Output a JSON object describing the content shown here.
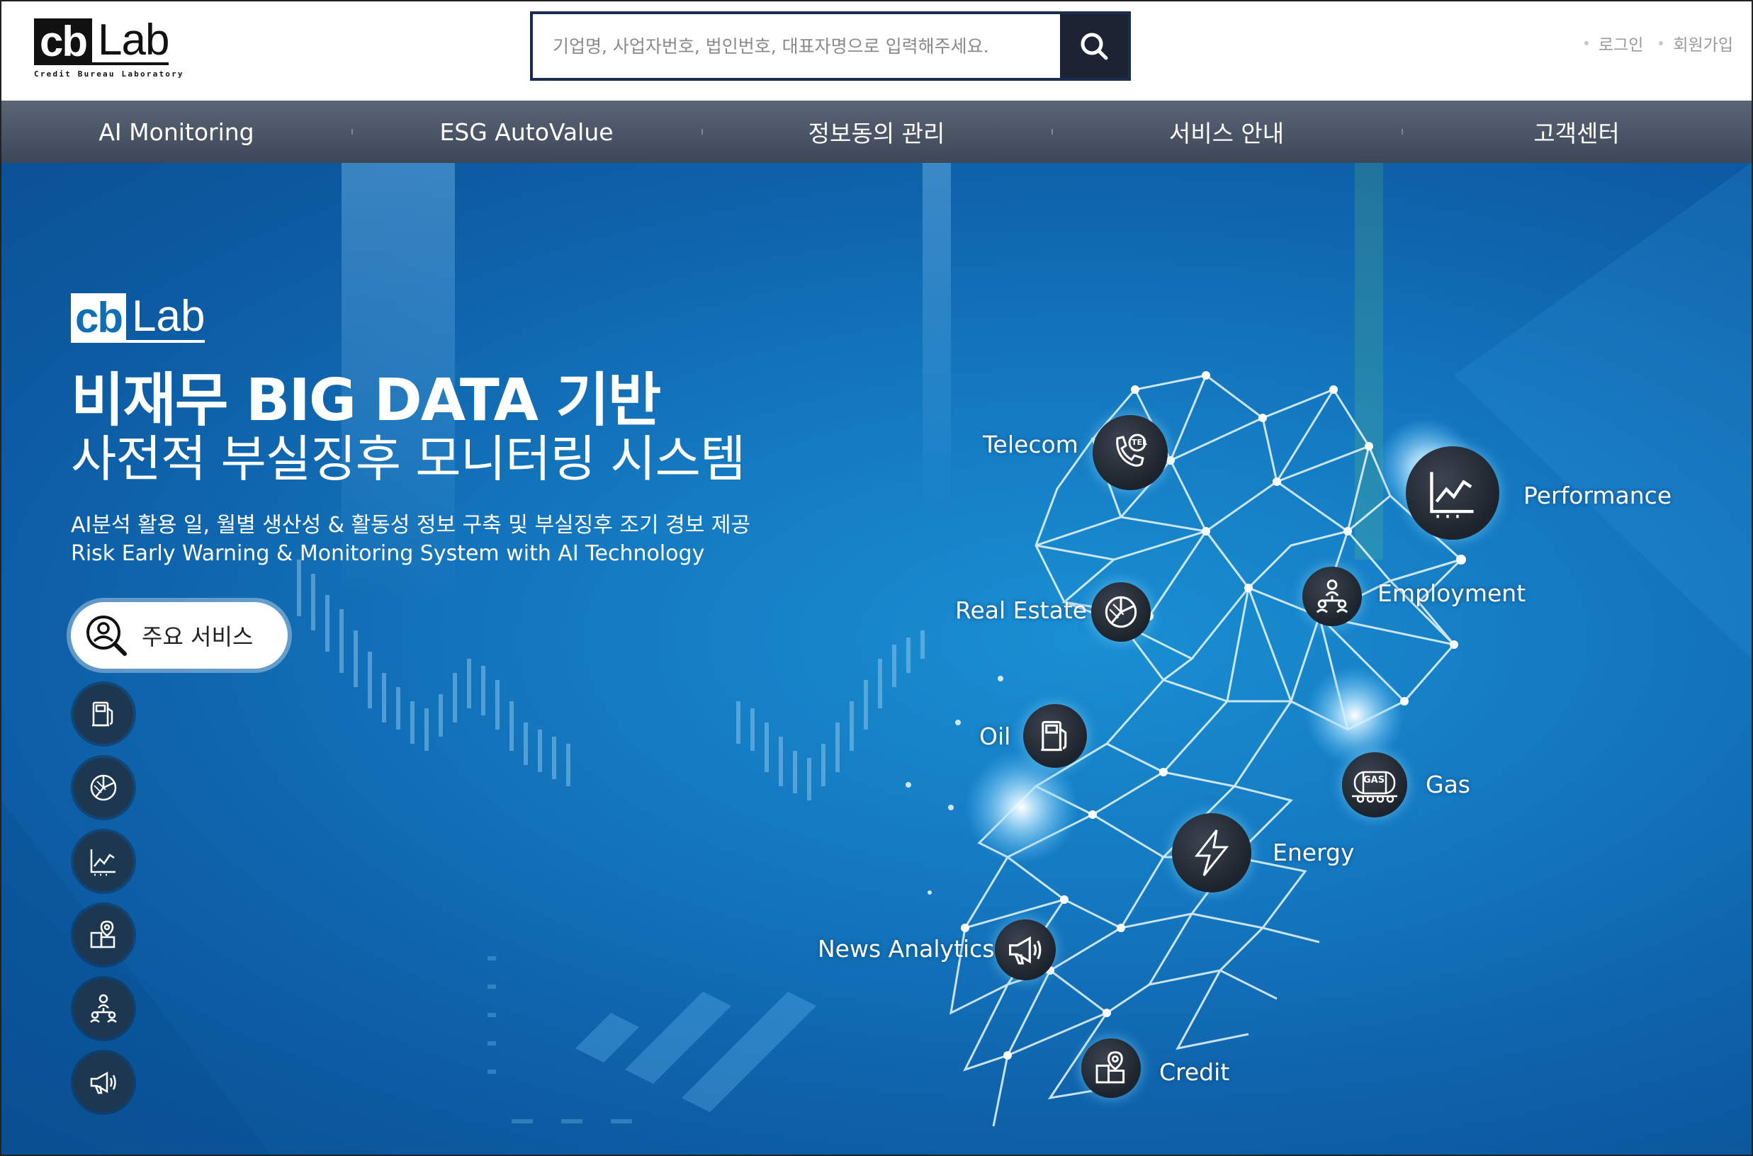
{
  "header": {
    "logo": {
      "mark": "cb",
      "word": "Lab",
      "tagline": "Credit Bureau Laboratory"
    },
    "search": {
      "placeholder": "기업명, 사업자번호, 법인번호, 대표자명으로 입력해주세요.",
      "value": ""
    },
    "auth": {
      "login": "로그인",
      "signup": "회원가입"
    }
  },
  "nav": {
    "items": [
      {
        "label": "AI Monitoring"
      },
      {
        "label": "ESG AutoValue"
      },
      {
        "label": "정보동의 관리"
      },
      {
        "label": "서비스 안내"
      },
      {
        "label": "고객센터"
      }
    ]
  },
  "hero": {
    "logo": {
      "mark": "cb",
      "word": "Lab"
    },
    "title_line1": "비재무 BIG DATA 기반",
    "title_line2": "사전적 부실징후 모니터링 시스템",
    "desc_ko": "AI분석 활용 일, 월별 생산성 & 활동성 정보 구축 및 부실징후 조기 경보 제공",
    "desc_en": "Risk Early Warning & Monitoring System with AI Technology",
    "main_service_label": "주요 서비스",
    "side_icons": [
      "fuel-pump-icon",
      "pie-chart-icon",
      "line-chart-icon",
      "building-pin-icon",
      "org-chart-icon",
      "megaphone-icon"
    ],
    "categories": {
      "telecom": "Telecom",
      "performance": "Performance",
      "real_estate": "Real Estate",
      "employment": "Employment",
      "oil": "Oil",
      "gas": "Gas",
      "energy": "Energy",
      "news": "News Analytics",
      "credit": "Credit"
    },
    "gas_badge": "GAS",
    "tel_badge": "TEL"
  },
  "colors": {
    "nav_bg": "#4a5566",
    "search_border": "#1b2d4f",
    "hero_blue": "#1478c0",
    "node_dark": "#1c232c"
  }
}
